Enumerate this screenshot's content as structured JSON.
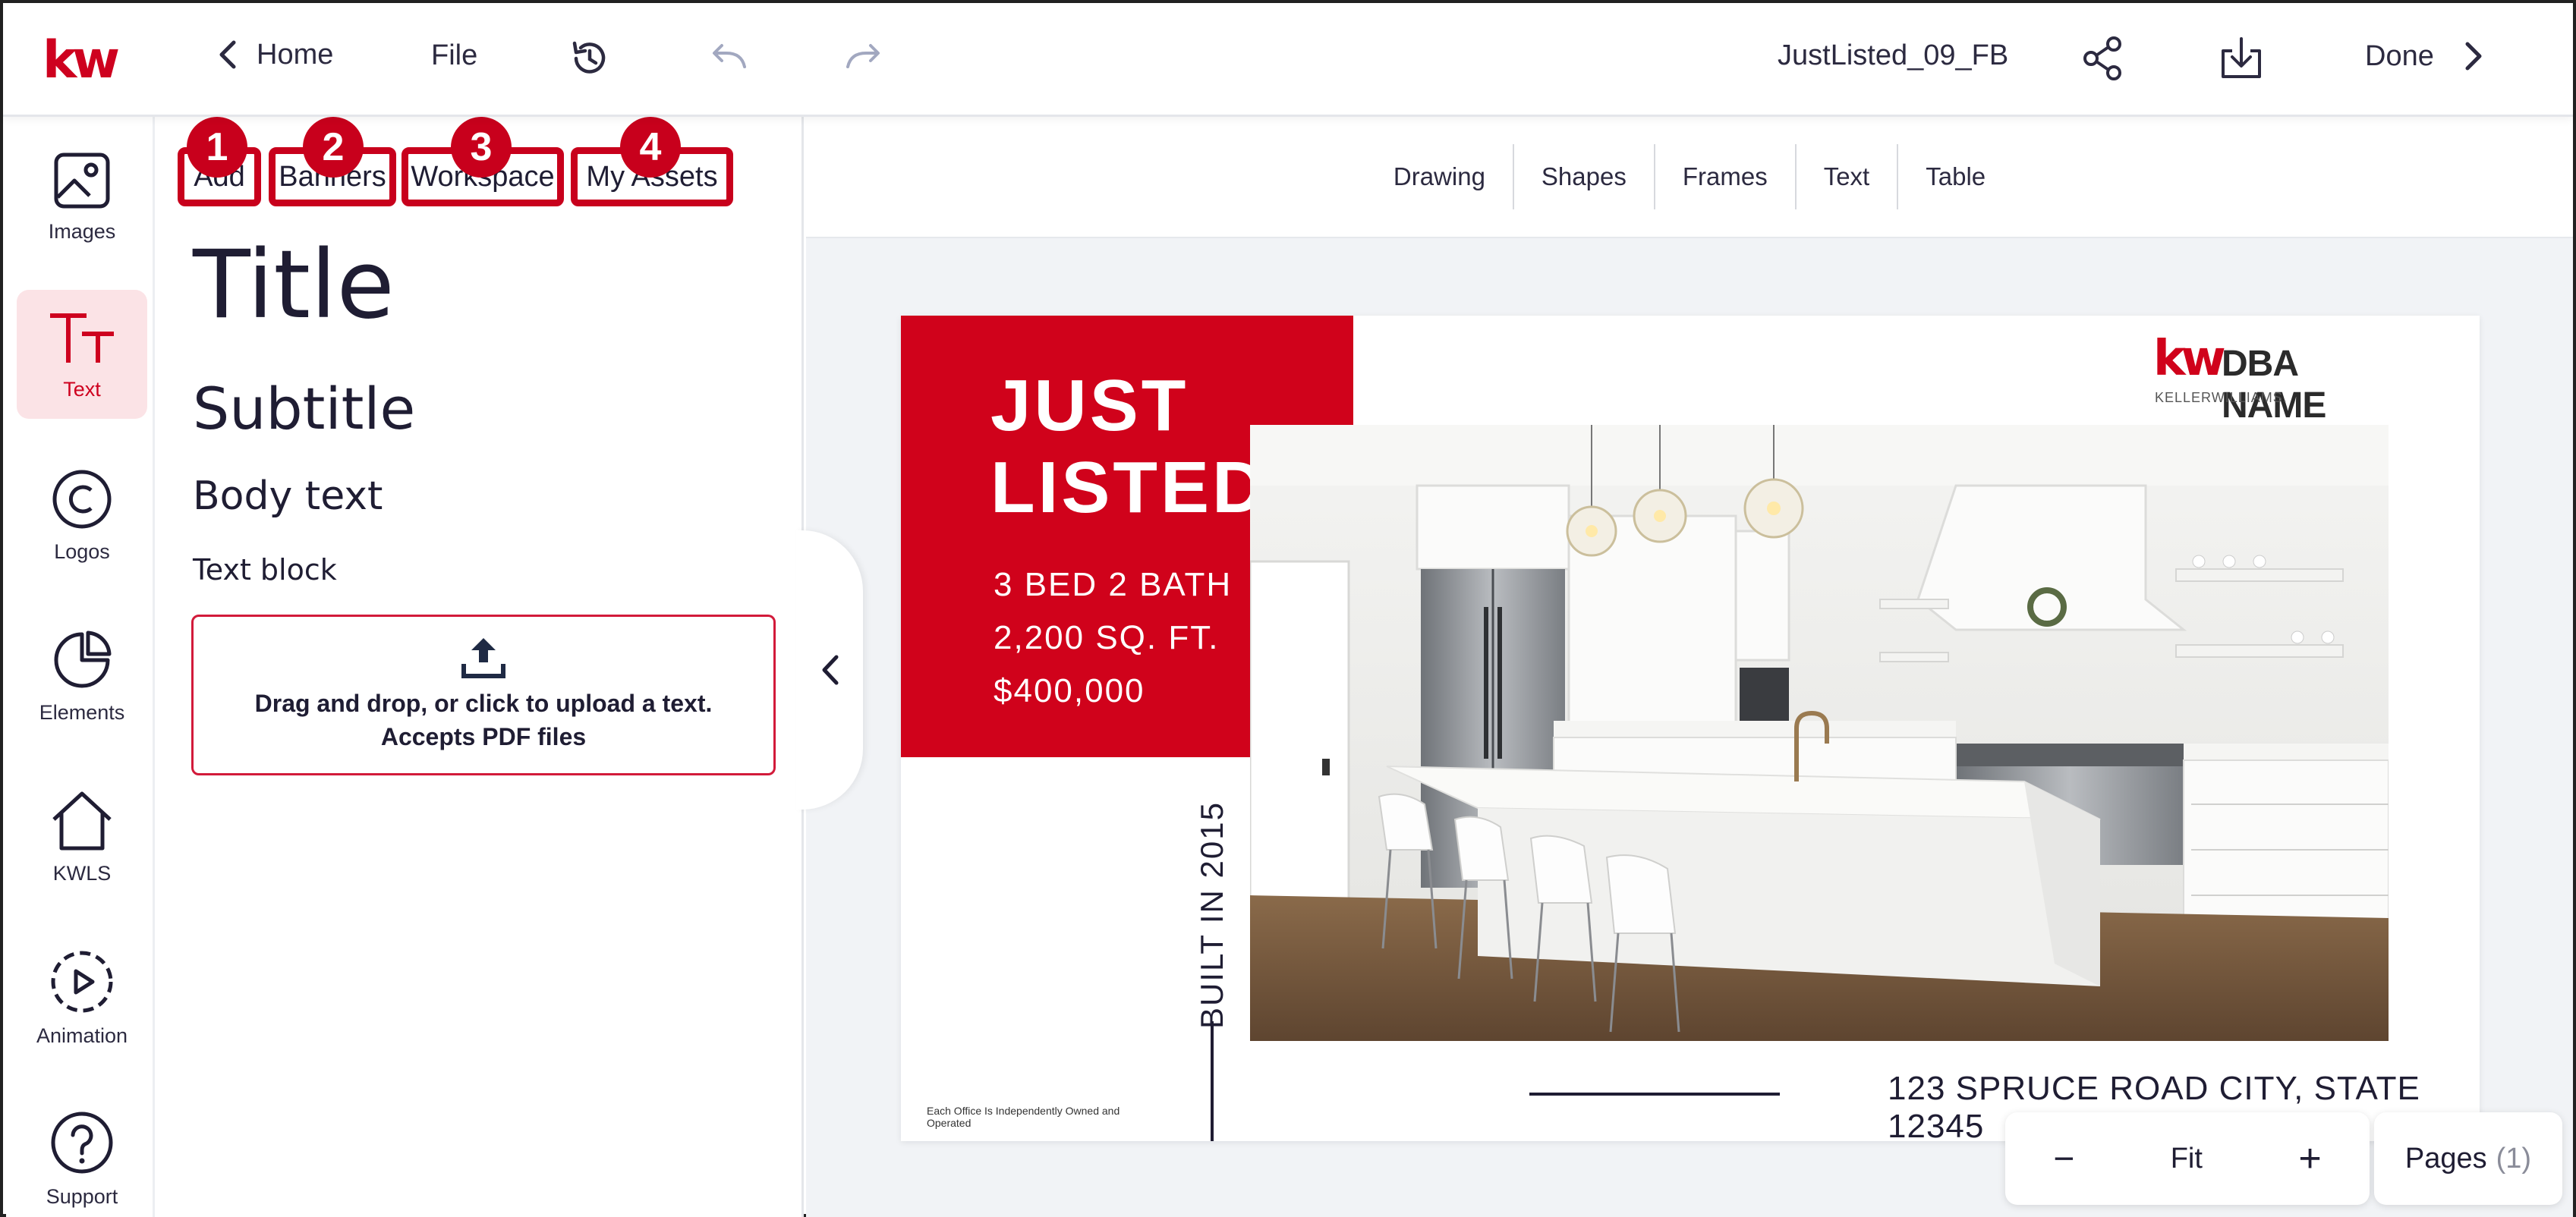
{
  "app": {
    "logo_text": "kw",
    "file_name": "JustListed_09_FB"
  },
  "header": {
    "home_label": "Home",
    "file_label": "File",
    "done_label": "Done",
    "icons": [
      "back-chevron-icon",
      "history-icon",
      "undo-icon",
      "redo-icon",
      "share-icon",
      "download-icon",
      "forward-chevron-icon"
    ]
  },
  "rail": {
    "items": [
      {
        "label": "Images",
        "icon": "image-icon"
      },
      {
        "label": "Text",
        "icon": "text-icon",
        "active": true
      },
      {
        "label": "Logos",
        "icon": "copyright-icon"
      },
      {
        "label": "Elements",
        "icon": "pie-icon"
      },
      {
        "label": "KWLS",
        "icon": "house-icon"
      },
      {
        "label": "Animation",
        "icon": "play-icon"
      },
      {
        "label": "Support",
        "icon": "help-icon"
      }
    ]
  },
  "panel": {
    "tabs": [
      {
        "label": "Add",
        "badge": "1"
      },
      {
        "label": "Banners",
        "badge": "2"
      },
      {
        "label": "Workspace",
        "badge": "3"
      },
      {
        "label": "My Assets",
        "badge": "4"
      }
    ],
    "title_sample": "Title",
    "subtitle_sample": "Subtitle",
    "body_sample": "Body text",
    "block_sample": "Text block",
    "upload_text": "Drag and drop, or click to upload a text. Accepts PDF files"
  },
  "toolbar": {
    "tools": [
      "Drawing",
      "Shapes",
      "Frames",
      "Text",
      "Table"
    ]
  },
  "design": {
    "headline_line1": "JUST",
    "headline_line2": "LISTED",
    "spec_beds": "3 BED 2 BATH",
    "spec_sqft": "2,200 SQ. FT.",
    "spec_price": "$400,000",
    "brand_kw": "kw",
    "brand_name": "DBA NAME",
    "brand_sub": "KELLERWILLIAMS.",
    "built_text": "BUILT IN 2015",
    "address": "123 SPRUCE ROAD CITY, STATE 12345",
    "fine_print": "Each Office Is Independently Owned and Operated",
    "accent_color": "#d0021b"
  },
  "zoom": {
    "minus": "−",
    "fit_label": "Fit",
    "plus": "+"
  },
  "pages": {
    "label": "Pages",
    "count": "(1)"
  }
}
